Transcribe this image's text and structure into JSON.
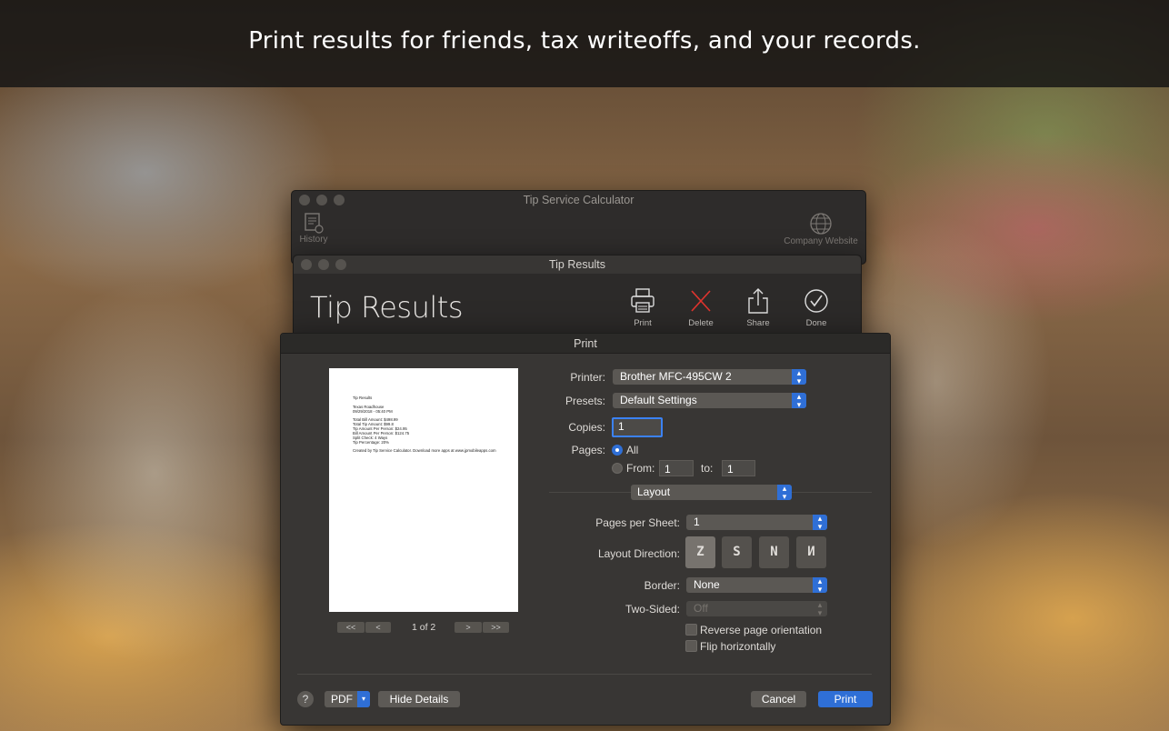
{
  "banner": {
    "text": "Print results for friends, tax writeoffs, and your records."
  },
  "main_window": {
    "title": "Tip Service Calculator",
    "history_label": "History",
    "website_label": "Company Website"
  },
  "results_window": {
    "title": "Tip Results",
    "heading": "Tip Results",
    "actions": {
      "print": "Print",
      "delete": "Delete",
      "share": "Share",
      "done": "Done"
    }
  },
  "print_dialog": {
    "title": "Print",
    "preview": {
      "lines": [
        "Tip Results",
        "Texas Roadhouse",
        "09/29/2018 - 05:40 PM",
        "Total Bill Amount: $498.99",
        "Total Tip Amount: $99.8",
        "Tip Amount Per Person: $24.95",
        "Bill Amount Per Person: $124.75",
        "Split Check: 4 Ways",
        "Tip Percentage: 20%",
        "Created by Tip Service Calculator. Download more apps at www.jpmobileapps.com"
      ],
      "page_indicator": "1 of 2",
      "first_label": "<<",
      "prev_label": "<",
      "next_label": ">",
      "last_label": ">>"
    },
    "printer": {
      "label": "Printer:",
      "value": "Brother MFC-495CW 2"
    },
    "presets": {
      "label": "Presets:",
      "value": "Default Settings"
    },
    "copies": {
      "label": "Copies:",
      "value": "1"
    },
    "pages": {
      "label": "Pages:",
      "all_label": "All",
      "from_label": "From:",
      "from_value": "1",
      "to_label": "to:",
      "to_value": "1"
    },
    "section": {
      "value": "Layout"
    },
    "pages_per_sheet": {
      "label": "Pages per Sheet:",
      "value": "1"
    },
    "layout_direction": {
      "label": "Layout Direction:",
      "options": [
        "Z",
        "S",
        "N",
        "И"
      ]
    },
    "border": {
      "label": "Border:",
      "value": "None"
    },
    "two_sided": {
      "label": "Two-Sided:",
      "value": "Off"
    },
    "reverse_orientation": {
      "label": "Reverse page orientation"
    },
    "flip_horizontally": {
      "label": "Flip horizontally"
    },
    "footer": {
      "help": "?",
      "pdf": "PDF",
      "hide_details": "Hide Details",
      "cancel": "Cancel",
      "print": "Print"
    }
  },
  "colors": {
    "accent": "#2f6fd6",
    "delete": "#e0342e",
    "sheet_bg": "#383634"
  }
}
